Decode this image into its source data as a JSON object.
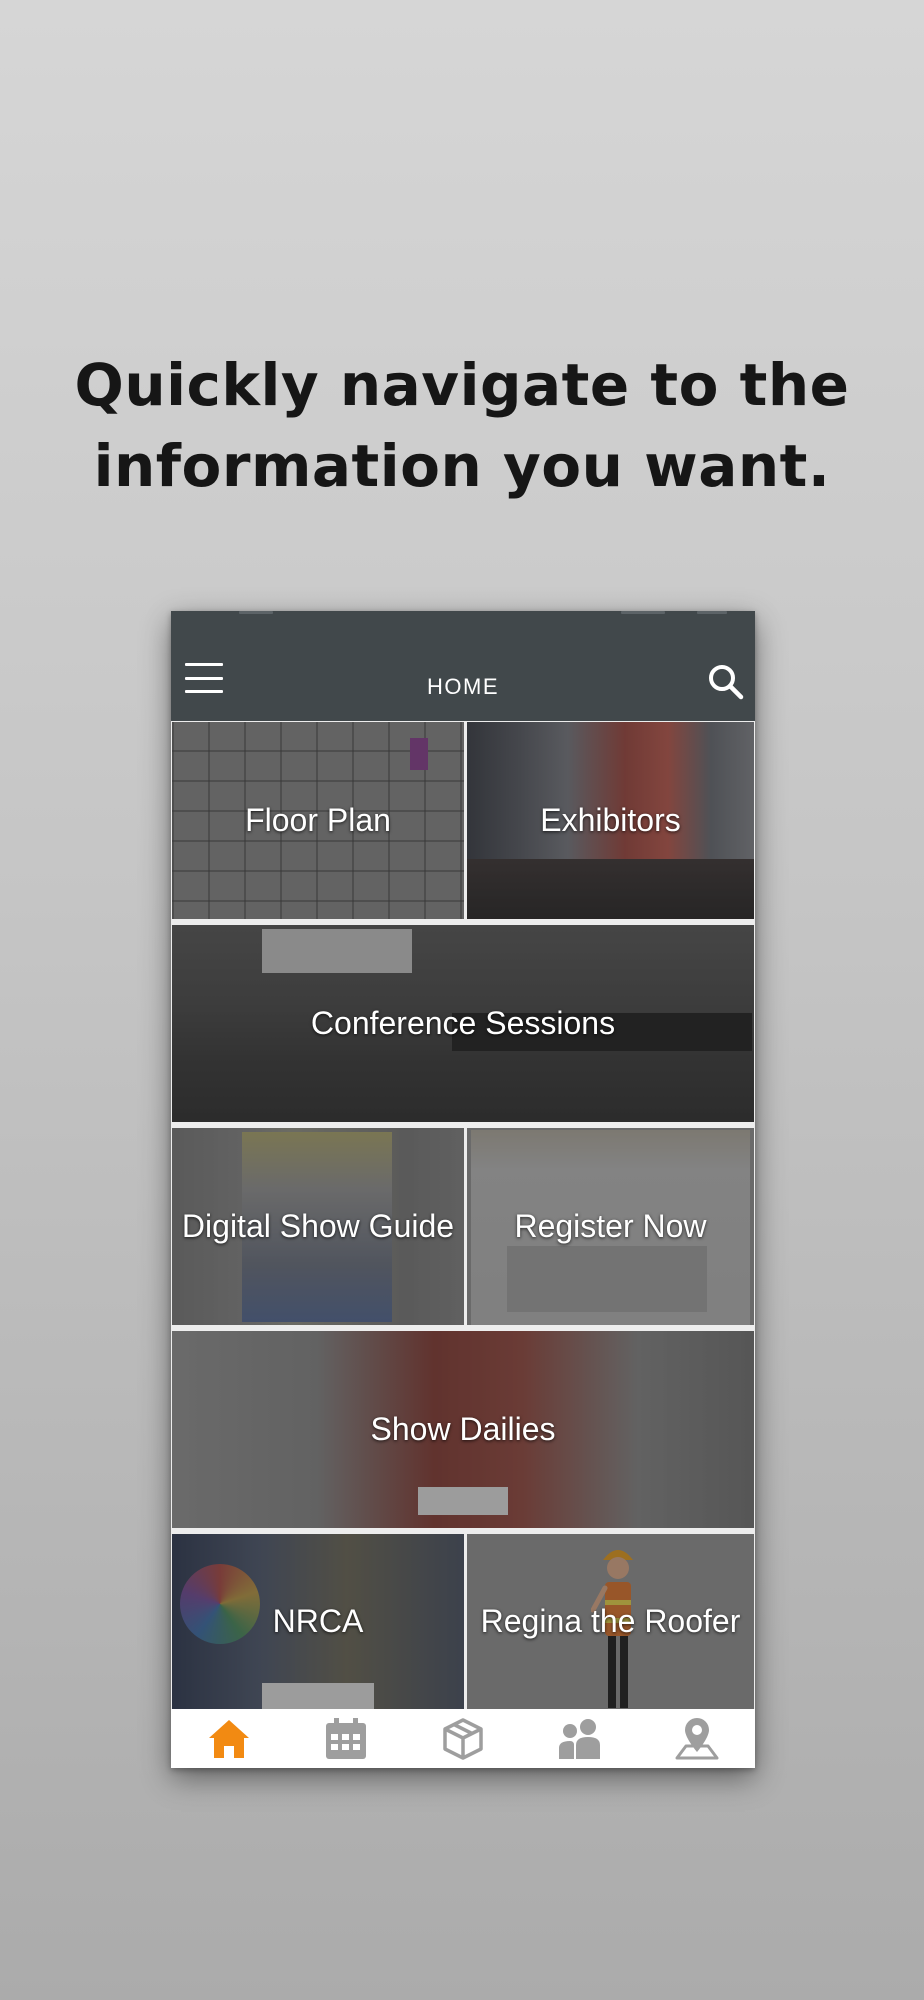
{
  "headline": {
    "line1": "Quickly navigate to the",
    "line2": "information you want."
  },
  "navbar": {
    "title": "HOME",
    "menu_icon": "hamburger-menu-icon",
    "search_icon": "search-icon"
  },
  "tiles": [
    {
      "label": "Floor Plan"
    },
    {
      "label": "Exhibitors"
    },
    {
      "label": "Conference Sessions"
    },
    {
      "label": "Digital Show Guide"
    },
    {
      "label": "Register Now"
    },
    {
      "label": "Show Dailies"
    },
    {
      "label": "NRCA"
    },
    {
      "label": "Regina the Roofer"
    }
  ],
  "tabbar": {
    "active_color": "#f28a12",
    "inactive_color": "#9e9e9e",
    "tabs": [
      {
        "icon": "home-icon",
        "active": true
      },
      {
        "icon": "calendar-icon",
        "active": false
      },
      {
        "icon": "box-icon",
        "active": false
      },
      {
        "icon": "people-icon",
        "active": false
      },
      {
        "icon": "map-pin-icon",
        "active": false
      }
    ]
  }
}
